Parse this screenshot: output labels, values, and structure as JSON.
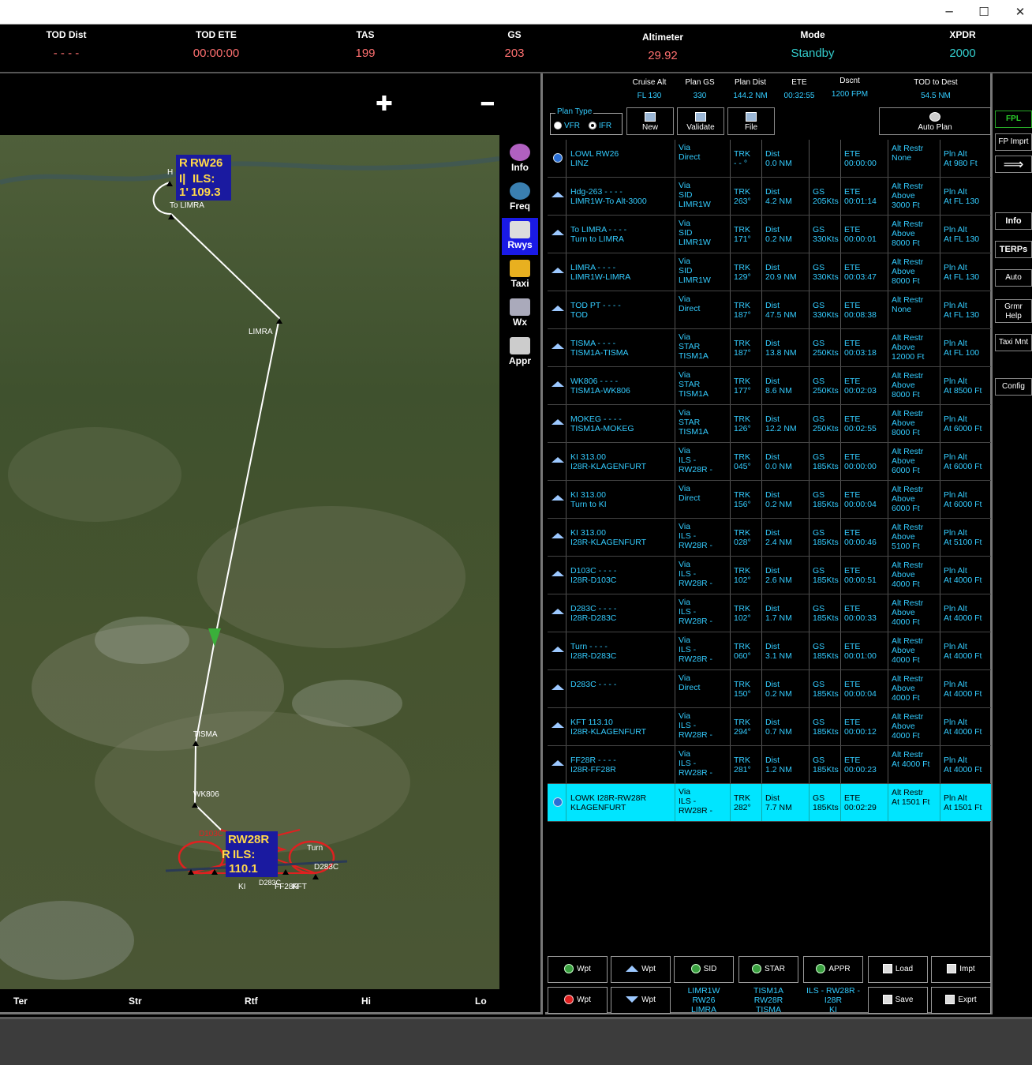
{
  "window": {
    "minimize": "─",
    "maximize": "☐",
    "close": "✕"
  },
  "hud": [
    {
      "label": "TOD Dist",
      "value": "- - - -",
      "color": "#ff7070"
    },
    {
      "label": "TOD ETE",
      "value": "00:00:00",
      "color": "#ff7070"
    },
    {
      "label": "TAS",
      "value": "199",
      "color": "#ff7070"
    },
    {
      "label": "GS",
      "value": "203",
      "color": "#ff7070"
    },
    {
      "label": "Altimeter",
      "value": "29.92",
      "color": "#ff7070"
    },
    {
      "label": "Mode",
      "value": "Standby",
      "color": "#33cccc"
    },
    {
      "label": "XPDR",
      "value": "2000",
      "color": "#33cccc"
    }
  ],
  "map": {
    "zoom_in": "✚",
    "zoom_out": "━",
    "labels": {
      "rw26": "RW26",
      "ils_top_1": "ILS:",
      "ils_top_2": "109.3",
      "box_top_left": "R",
      "box_top_left2": "I|",
      "box_top_left3": "1'",
      "to_limra": "To LIMRA",
      "hdg": "H",
      "limra": "LIMRA",
      "tisma": "TISMA",
      "wk806": "WK806",
      "rw28r": "RW28R",
      "ils_bot": "ILS:",
      "ils_bot_freq": "110.1",
      "box_bot_left": "R",
      "turn": "Turn",
      "d283c": "D283C",
      "ki": "KI",
      "ff28r": "FF28R",
      "kft": "KFT",
      "d103c": "D103C",
      "d203c": "D283C"
    },
    "tools": [
      {
        "label": "Info",
        "icon": "info-icon",
        "active": false
      },
      {
        "label": "Freq",
        "icon": "freq-icon",
        "active": false
      },
      {
        "label": "Rwys",
        "icon": "runway-icon",
        "active": true
      },
      {
        "label": "Taxi",
        "icon": "taxi-icon",
        "active": false
      },
      {
        "label": "Wx",
        "icon": "weather-icon",
        "active": false
      },
      {
        "label": "Appr",
        "icon": "approach-icon",
        "active": false
      }
    ],
    "toggles": [
      "Ter",
      "Str",
      "Rtf",
      "Hi",
      "Lo"
    ]
  },
  "plan_header": {
    "cruise_alt": {
      "label": "Cruise Alt",
      "value": "FL 130"
    },
    "plan_gs": {
      "label": "Plan GS",
      "value": "330"
    },
    "plan_dist": {
      "label": "Plan Dist",
      "value": "144.2 NM"
    },
    "ete": {
      "label": "ETE",
      "value": "00:32:55"
    },
    "dscnt": {
      "label": "Dscnt",
      "value": "1200 FPM"
    },
    "tod_to_dest": {
      "label": "TOD to Dest",
      "value": "54.5 NM"
    },
    "plan_type_label": "Plan Type",
    "vfr": "VFR",
    "ifr": "IFR",
    "new": "New",
    "validate": "Validate",
    "file": "File",
    "auto_plan": "Auto Plan"
  },
  "rows": [
    {
      "icon": "airport",
      "n1": "LOWL  RW26",
      "n2": "LINZ",
      "via1": "Via",
      "via2": "Direct",
      "via3": "",
      "trk": "- - °",
      "dist": "0.0 NM",
      "gs": "",
      "ete": "00:00:00",
      "ar1": "Alt Restr",
      "ar2": "None",
      "ar3": "",
      "pa1": "Pln Alt",
      "pa2": "At 980 Ft",
      "sel": false
    },
    {
      "icon": "wpt",
      "n1": "Hdg-263   - - - -",
      "n2": "LIMR1W-To Alt-3000",
      "via1": "Via",
      "via2": "SID",
      "via3": "LIMR1W",
      "trk": "263°",
      "dist": "4.2 NM",
      "gs": "205Kts",
      "ete": "00:01:14",
      "ar1": "Alt Restr",
      "ar2": "Above",
      "ar3": "3000 Ft",
      "pa1": "Pln Alt",
      "pa2": "At FL 130",
      "sel": false
    },
    {
      "icon": "wpt",
      "n1": "To LIMRA   - - - -",
      "n2": "Turn to LIMRA",
      "via1": "Via",
      "via2": "SID",
      "via3": "LIMR1W",
      "trk": "171°",
      "dist": "0.2 NM",
      "gs": "330Kts",
      "ete": "00:00:01",
      "ar1": "Alt Restr",
      "ar2": "Above",
      "ar3": "8000 Ft",
      "pa1": "Pln Alt",
      "pa2": "At FL 130",
      "sel": false
    },
    {
      "icon": "wpt",
      "n1": "LIMRA   - - - -",
      "n2": "LIMR1W-LIMRA",
      "via1": "Via",
      "via2": "SID",
      "via3": "LIMR1W",
      "trk": "129°",
      "dist": "20.9 NM",
      "gs": "330Kts",
      "ete": "00:03:47",
      "ar1": "Alt Restr",
      "ar2": "Above",
      "ar3": "8000 Ft",
      "pa1": "Pln Alt",
      "pa2": "At FL 130",
      "sel": false
    },
    {
      "icon": "wpt",
      "n1": "TOD PT   - - - -",
      "n2": "TOD",
      "via1": "Via",
      "via2": "Direct",
      "via3": "",
      "trk": "187°",
      "dist": "47.5 NM",
      "gs": "330Kts",
      "ete": "00:08:38",
      "ar1": "Alt Restr",
      "ar2": "None",
      "ar3": "",
      "pa1": "Pln Alt",
      "pa2": "At FL 130",
      "sel": false
    },
    {
      "icon": "wpt",
      "n1": "TISMA   - - - -",
      "n2": "TISM1A-TISMA",
      "via1": "Via",
      "via2": "STAR",
      "via3": "TISM1A",
      "trk": "187°",
      "dist": "13.8 NM",
      "gs": "250Kts",
      "ete": "00:03:18",
      "ar1": "Alt Restr",
      "ar2": "Above",
      "ar3": "12000 Ft",
      "pa1": "Pln Alt",
      "pa2": "At FL 100",
      "sel": false
    },
    {
      "icon": "wpt",
      "n1": "WK806   - - - -",
      "n2": "TISM1A-WK806",
      "via1": "Via",
      "via2": "STAR",
      "via3": "TISM1A",
      "trk": "177°",
      "dist": "8.6 NM",
      "gs": "250Kts",
      "ete": "00:02:03",
      "ar1": "Alt Restr",
      "ar2": "Above",
      "ar3": "8000 Ft",
      "pa1": "Pln Alt",
      "pa2": "At 8500 Ft",
      "sel": false
    },
    {
      "icon": "wpt",
      "n1": "MOKEG   - - - -",
      "n2": "TISM1A-MOKEG",
      "via1": "Via",
      "via2": "STAR",
      "via3": "TISM1A",
      "trk": "126°",
      "dist": "12.2 NM",
      "gs": "250Kts",
      "ete": "00:02:55",
      "ar1": "Alt Restr",
      "ar2": "Above",
      "ar3": "8000 Ft",
      "pa1": "Pln Alt",
      "pa2": "At 6000 Ft",
      "sel": false
    },
    {
      "icon": "wpt",
      "n1": "KI   313.00",
      "n2": "I28R-KLAGENFURT",
      "via1": "Via",
      "via2": "ILS -",
      "via3": "RW28R -",
      "trk": "045°",
      "dist": "0.0 NM",
      "gs": "185Kts",
      "ete": "00:00:00",
      "ar1": "Alt Restr",
      "ar2": "Above",
      "ar3": "6000 Ft",
      "pa1": "Pln Alt",
      "pa2": "At 6000 Ft",
      "sel": false
    },
    {
      "icon": "wpt",
      "n1": "KI   313.00",
      "n2": "Turn to KI",
      "via1": "Via",
      "via2": "Direct",
      "via3": "",
      "trk": "156°",
      "dist": "0.2 NM",
      "gs": "185Kts",
      "ete": "00:00:04",
      "ar1": "Alt Restr",
      "ar2": "Above",
      "ar3": "6000 Ft",
      "pa1": "Pln Alt",
      "pa2": "At 6000 Ft",
      "sel": false
    },
    {
      "icon": "wpt",
      "n1": "KI   313.00",
      "n2": "I28R-KLAGENFURT",
      "via1": "Via",
      "via2": "ILS -",
      "via3": "RW28R -",
      "trk": "028°",
      "dist": "2.4 NM",
      "gs": "185Kts",
      "ete": "00:00:46",
      "ar1": "Alt Restr",
      "ar2": "Above",
      "ar3": "5100 Ft",
      "pa1": "Pln Alt",
      "pa2": "At 5100 Ft",
      "sel": false
    },
    {
      "icon": "wpt",
      "n1": "D103C   - - - -",
      "n2": "I28R-D103C",
      "via1": "Via",
      "via2": "ILS -",
      "via3": "RW28R -",
      "trk": "102°",
      "dist": "2.6 NM",
      "gs": "185Kts",
      "ete": "00:00:51",
      "ar1": "Alt Restr",
      "ar2": "Above",
      "ar3": "4000 Ft",
      "pa1": "Pln Alt",
      "pa2": "At 4000 Ft",
      "sel": false
    },
    {
      "icon": "wpt",
      "n1": "D283C   - - - -",
      "n2": "I28R-D283C",
      "via1": "Via",
      "via2": "ILS -",
      "via3": "RW28R -",
      "trk": "102°",
      "dist": "1.7 NM",
      "gs": "185Kts",
      "ete": "00:00:33",
      "ar1": "Alt Restr",
      "ar2": "Above",
      "ar3": "4000 Ft",
      "pa1": "Pln Alt",
      "pa2": "At 4000 Ft",
      "sel": false
    },
    {
      "icon": "wpt",
      "n1": "Turn   - - - -",
      "n2": "I28R-D283C",
      "via1": "Via",
      "via2": "ILS -",
      "via3": "RW28R -",
      "trk": "060°",
      "dist": "3.1 NM",
      "gs": "185Kts",
      "ete": "00:01:00",
      "ar1": "Alt Restr",
      "ar2": "Above",
      "ar3": "4000 Ft",
      "pa1": "Pln Alt",
      "pa2": "At 4000 Ft",
      "sel": false
    },
    {
      "icon": "wpt",
      "n1": "D283C   - - - -",
      "n2": "",
      "via1": "Via",
      "via2": "Direct",
      "via3": "",
      "trk": "150°",
      "dist": "0.2 NM",
      "gs": "185Kts",
      "ete": "00:00:04",
      "ar1": "Alt Restr",
      "ar2": "Above",
      "ar3": "4000 Ft",
      "pa1": "Pln Alt",
      "pa2": "At 4000 Ft",
      "sel": false
    },
    {
      "icon": "wpt",
      "n1": "KFT   113.10",
      "n2": "I28R-KLAGENFURT",
      "via1": "Via",
      "via2": "ILS -",
      "via3": "RW28R -",
      "trk": "294°",
      "dist": "0.7 NM",
      "gs": "185Kts",
      "ete": "00:00:12",
      "ar1": "Alt Restr",
      "ar2": "Above",
      "ar3": "4000 Ft",
      "pa1": "Pln Alt",
      "pa2": "At 4000 Ft",
      "sel": false
    },
    {
      "icon": "wpt",
      "n1": "FF28R   - - - -",
      "n2": "I28R-FF28R",
      "via1": "Via",
      "via2": "ILS -",
      "via3": "RW28R -",
      "trk": "281°",
      "dist": "1.2 NM",
      "gs": "185Kts",
      "ete": "00:00:23",
      "ar1": "Alt Restr",
      "ar2": "At 4000 Ft",
      "ar3": "",
      "pa1": "Pln Alt",
      "pa2": "At 4000 Ft",
      "sel": false
    },
    {
      "icon": "airport",
      "n1": "LOWK  I28R-RW28R",
      "n2": "KLAGENFURT",
      "via1": "Via",
      "via2": "ILS -",
      "via3": "RW28R -",
      "trk": "282°",
      "dist": "7.7 NM",
      "gs": "185Kts",
      "ete": "00:02:29",
      "ar1": "Alt Restr",
      "ar2": "At 1501 Ft",
      "ar3": "",
      "pa1": "Pln Alt",
      "pa2": "At 1501 Ft",
      "sel": true
    }
  ],
  "row_labels": {
    "trk": "TRK",
    "dist": "Dist",
    "gs": "GS",
    "ete": "ETE"
  },
  "bottom": {
    "add_wpt": "Wpt",
    "up_wpt": "Wpt",
    "sid": "SID",
    "star": "STAR",
    "appr": "APPR",
    "load": "Load",
    "impt": "Impt",
    "del_wpt": "Wpt",
    "down_wpt": "Wpt",
    "save": "Save",
    "expt": "Exprt",
    "sid_info": [
      "LIMR1W",
      "RW26",
      "LIMRA"
    ],
    "star_info": [
      "TISM1A",
      "RW28R",
      "TISMA"
    ],
    "appr_info": [
      "ILS - RW28R -",
      "I28R",
      "KI"
    ]
  },
  "rightbar": [
    {
      "label": "FPL",
      "active": true
    },
    {
      "label": "FP Imprt",
      "active": false
    },
    {
      "label": "⟹",
      "active": false
    },
    {
      "label": "Info",
      "active": false
    },
    {
      "label": "TERPs",
      "active": false
    },
    {
      "label": "Auto",
      "active": false
    },
    {
      "label": "Grmr Help",
      "active": false
    },
    {
      "label": "Taxi Mnt",
      "active": false
    },
    {
      "label": "Config",
      "active": false
    }
  ]
}
